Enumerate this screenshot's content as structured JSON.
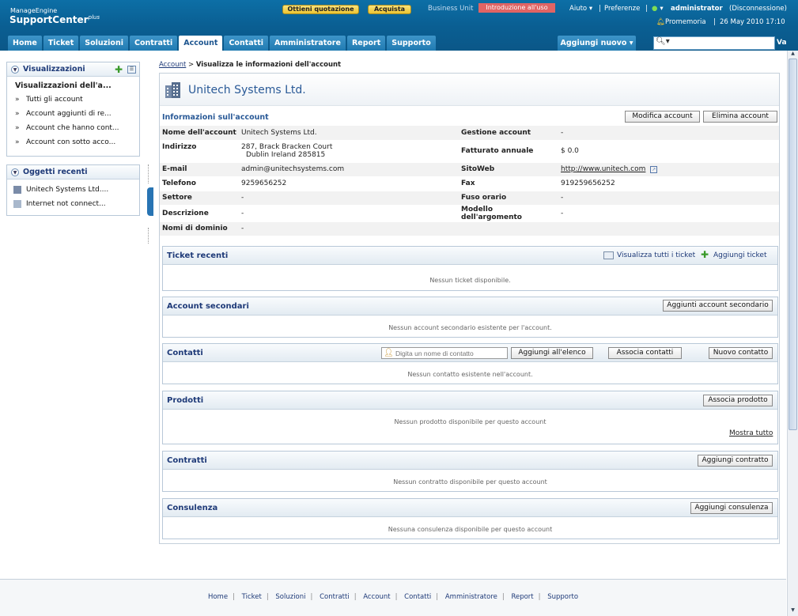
{
  "header": {
    "logo_small": "ManageEngine",
    "logo_big": "SupportCenter",
    "logo_plus": "plus",
    "quote_button": "Ottieni quotazione",
    "buy_button": "Acquista",
    "business_unit_label": "Business Unit",
    "business_unit_value": "Introduzione all'uso",
    "help_link": "Aiuto",
    "preferences_link": "Preferenze",
    "user_name": "administrator",
    "logout_link": "(Disconnessione)",
    "reminder_link": "Promemoria",
    "date_time": "26 May 2010 17:10",
    "separator": "|"
  },
  "nav": {
    "tabs": [
      "Home",
      "Ticket",
      "Soluzioni",
      "Contratti",
      "Account",
      "Contatti",
      "Amministratore",
      "Report",
      "Supporto"
    ],
    "active_tab": "Account",
    "add_new": "Aggiungi nuovo",
    "search_placeholder": "",
    "search_go": "Va"
  },
  "sidebar": {
    "views_title": "Visualizzazioni",
    "views_heading": "Visualizzazioni dell'a...",
    "views_items": [
      "Tutti gli account",
      "Account aggiunti di re...",
      "Account che hanno cont...",
      "Account con sotto acco..."
    ],
    "recent_title": "Oggetti recenti",
    "recent_items": [
      "Unitech Systems Ltd....",
      "Internet not connect..."
    ]
  },
  "breadcrumb": {
    "root": "Account",
    "sep": ">",
    "current": "Visualizza le informazioni dell'account"
  },
  "account": {
    "name": "Unitech Systems Ltd.",
    "info_title": "Informazioni sull'account",
    "edit_button": "Modifica account",
    "delete_button": "Elimina account",
    "fields": {
      "name_label": "Nome dell'account",
      "name_value": "Unitech Systems Ltd.",
      "mgmt_label": "Gestione account",
      "mgmt_value": "-",
      "address_label": "Indirizzo",
      "address_line1": "287, Brack  Bracken Court",
      "address_line2": "Dublin   Ireland  285815",
      "revenue_label": "Fatturato annuale",
      "revenue_value": "$ 0.0",
      "email_label": "E-mail",
      "email_value": "admin@unitechsystems.com",
      "website_label": "SitoWeb",
      "website_value": "http://www.unitech.com",
      "phone_label": "Telefono",
      "phone_value": "9259656252",
      "fax_label": "Fax",
      "fax_value": "919259656252",
      "sector_label": "Settore",
      "sector_value": "-",
      "timezone_label": "Fuso orario",
      "timezone_value": "-",
      "desc_label": "Descrizione",
      "desc_value": "-",
      "template_label": "Modello dell'argomento",
      "template_value": "-",
      "domains_label": "Nomi di dominio",
      "domains_value": "-"
    }
  },
  "sections": {
    "tickets": {
      "title": "Ticket recenti",
      "view_all": "Visualizza tutti i ticket",
      "add": "Aggiungi ticket",
      "empty": "Nessun ticket disponibile."
    },
    "sub_accounts": {
      "title": "Account secondari",
      "button": "Aggiunti account secondario",
      "empty": "Nessun account secondario esistente per l'account."
    },
    "contacts": {
      "title": "Contatti",
      "input_placeholder": "Digita un nome di contatto",
      "add_list": "Aggiungi all'elenco",
      "associate": "Associa contatti",
      "new": "Nuovo contatto",
      "empty": "Nessun contatto esistente nell'account."
    },
    "products": {
      "title": "Prodotti",
      "button": "Associa prodotto",
      "empty": "Nessun prodotto disponibile per questo account",
      "show_all": "Mostra tutto"
    },
    "contracts": {
      "title": "Contratti",
      "button": "Aggiungi contratto",
      "empty": "Nessun contratto disponibile per questo account"
    },
    "consulting": {
      "title": "Consulenza",
      "button": "Aggiungi consulenza",
      "empty": "Nessuna consulenza disponibile per questo account"
    }
  },
  "footer": {
    "links": [
      "Home",
      "Ticket",
      "Soluzioni",
      "Contratti",
      "Account",
      "Contatti",
      "Amministratore",
      "Report",
      "Supporto"
    ]
  }
}
